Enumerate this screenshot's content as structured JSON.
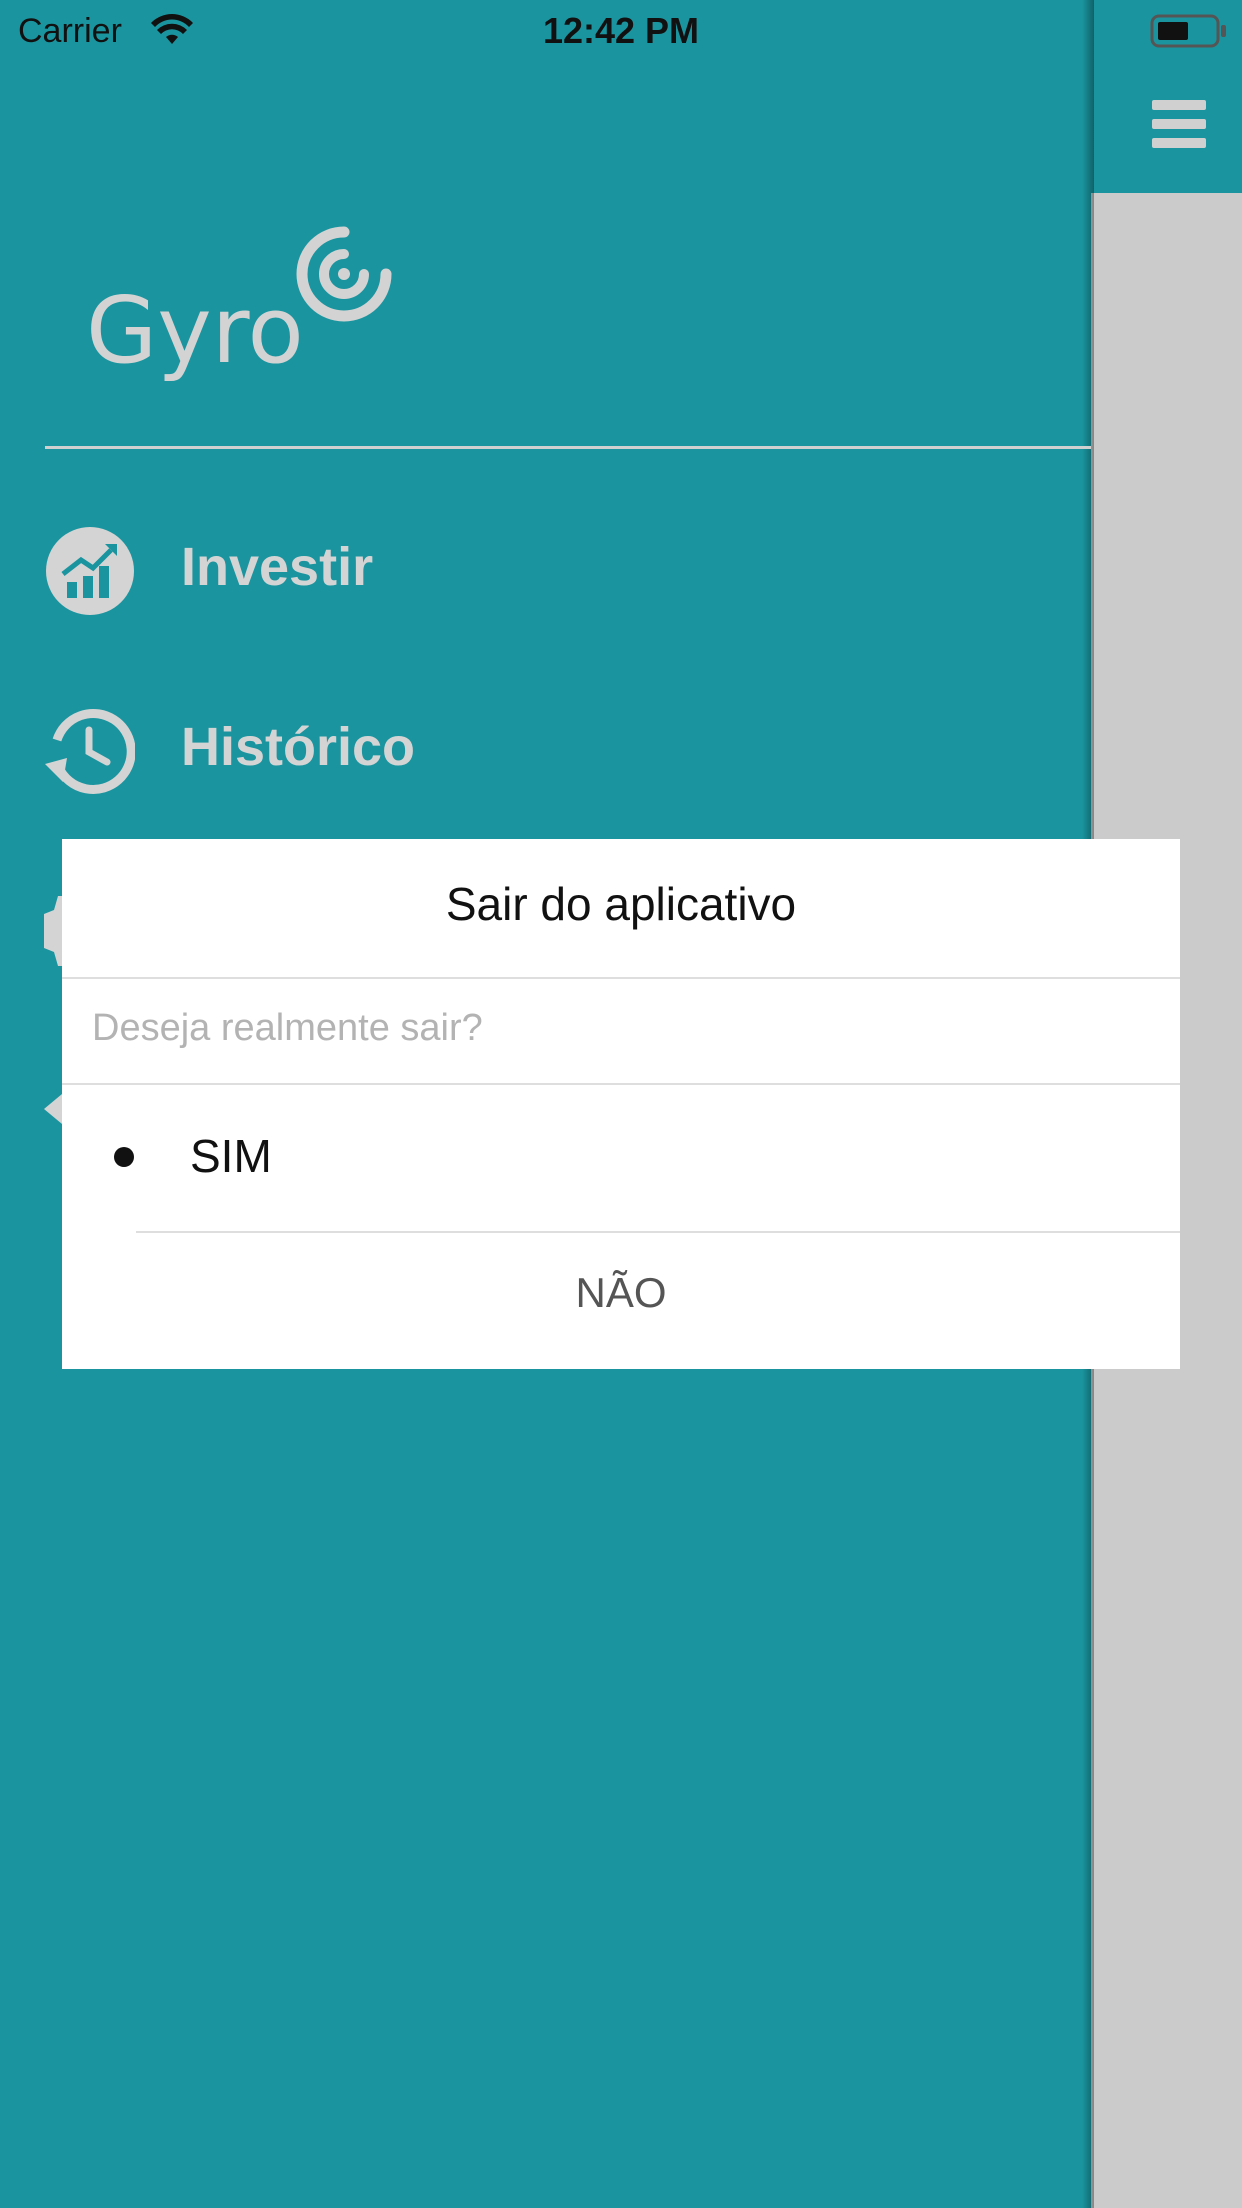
{
  "status_bar": {
    "carrier": "Carrier",
    "time": "12:42 PM",
    "wifi_icon": "wifi-icon",
    "battery_icon": "battery-icon"
  },
  "colors": {
    "primary": "#1a959f",
    "drawer_text": "#d4d4d4",
    "main_background": "#cbcbcb",
    "dialog_background": "#ffffff"
  },
  "drawer": {
    "logo_text": "Gyro",
    "menu": [
      {
        "label": "Investir",
        "icon": "chart-growth-icon"
      },
      {
        "label": "Histórico",
        "icon": "history-icon"
      },
      {
        "label": "",
        "icon": "gear-icon"
      },
      {
        "label": "",
        "icon": "back-arrow-icon"
      }
    ]
  },
  "main": {
    "menu_icon": "hamburger-icon"
  },
  "dialog": {
    "title": "Sair do aplicativo",
    "message": "Deseja realmente sair?",
    "options": [
      {
        "label": "SIM",
        "selected": true
      },
      {
        "label": "NÃO",
        "selected": false
      }
    ]
  }
}
